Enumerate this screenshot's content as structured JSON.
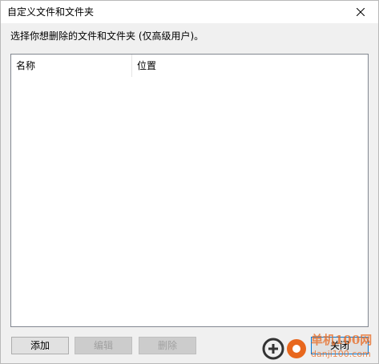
{
  "window": {
    "title": "自定义文件和文件夹"
  },
  "prompt": "选择你想删除的文件和文件夹 (仅高级用户)。",
  "list": {
    "columns": [
      "名称",
      "位置"
    ],
    "rows": []
  },
  "buttons": {
    "add": "添加",
    "edit": "编辑",
    "delete": "删除",
    "close": "关闭"
  },
  "watermark": {
    "line1": "单机100网",
    "line2": "danji100.com"
  },
  "colors": {
    "background": "#f0f0f0",
    "focus_border": "#0078d7",
    "watermark": "#e8671d"
  }
}
